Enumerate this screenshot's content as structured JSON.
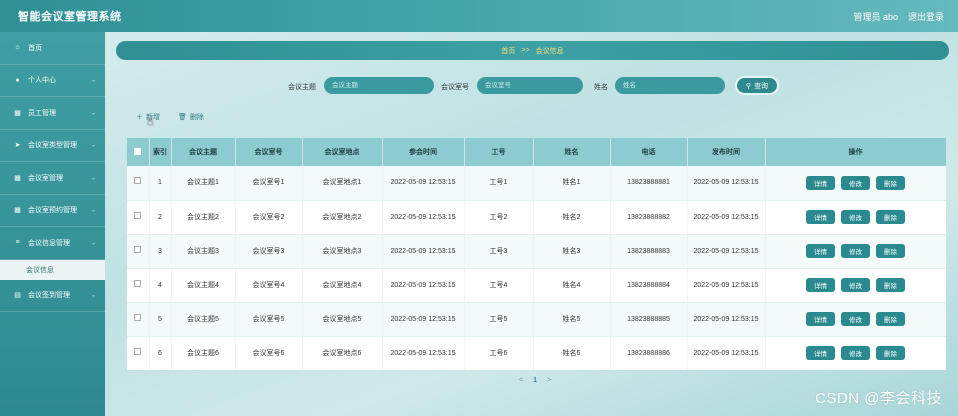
{
  "app": {
    "title": "智能会议室管理系统",
    "user_label": "管理员 abo",
    "logout_label": "退出登录"
  },
  "sidebar": {
    "items": [
      {
        "label": "首页",
        "icon": "home-icon",
        "glyph": "⌂"
      },
      {
        "label": "个人中心",
        "icon": "user-icon",
        "glyph": "●"
      },
      {
        "label": "员工管理",
        "icon": "grid-icon",
        "glyph": "▦"
      },
      {
        "label": "会议室类型管理",
        "icon": "send-icon",
        "glyph": "➤"
      },
      {
        "label": "会议室管理",
        "icon": "grid-icon",
        "glyph": "▦"
      },
      {
        "label": "会议室预约管理",
        "icon": "grid-icon",
        "glyph": "▦"
      },
      {
        "label": "会议信息管理",
        "icon": "list-icon",
        "glyph": "≡"
      },
      {
        "label": "会议签到管理",
        "icon": "doc-icon",
        "glyph": "▤"
      }
    ],
    "sub_item": "会议信息"
  },
  "breadcrumb": {
    "home": "首页",
    "sep": ">>",
    "current": "会议信息"
  },
  "search": {
    "topic_label": "会议主题",
    "topic_placeholder": "会议主题",
    "room_label": "会议室号",
    "room_placeholder": "会议室号",
    "name_label": "姓名",
    "name_placeholder": "姓名",
    "button_label": "查询"
  },
  "actions": {
    "add": "新增",
    "delete": "删除"
  },
  "table": {
    "headers": [
      "索引",
      "会议主题",
      "会议室号",
      "会议室地点",
      "参会时间",
      "工号",
      "姓名",
      "电话",
      "发布时间",
      "操作"
    ],
    "rows": [
      [
        "1",
        "会议主题1",
        "会议室号1",
        "会议室地点1",
        "2022-05-09 12:53:15",
        "工号1",
        "姓名1",
        "13823888881",
        "2022-05-09 12:53:15"
      ],
      [
        "2",
        "会议主题2",
        "会议室号2",
        "会议室地点2",
        "2022-05-09 12:53:15",
        "工号2",
        "姓名2",
        "13823888882",
        "2022-05-09 12:53:15"
      ],
      [
        "3",
        "会议主题3",
        "会议室号3",
        "会议室地点3",
        "2022-05-09 12:53:15",
        "工号3",
        "姓名3",
        "13823888883",
        "2022-05-09 12:53:15"
      ],
      [
        "4",
        "会议主题4",
        "会议室号4",
        "会议室地点4",
        "2022-05-09 12:53:15",
        "工号4",
        "姓名4",
        "13823888884",
        "2022-05-09 12:53:15"
      ],
      [
        "5",
        "会议主题5",
        "会议室号5",
        "会议室地点5",
        "2022-05-09 12:53:15",
        "工号5",
        "姓名5",
        "13823888885",
        "2022-05-09 12:53:15"
      ],
      [
        "6",
        "会议主题6",
        "会议室号6",
        "会议室地点6",
        "2022-05-09 12:53:15",
        "工号6",
        "姓名6",
        "13823888886",
        "2022-05-09 12:53:15"
      ]
    ],
    "op_labels": {
      "detail": "详情",
      "edit": "修改",
      "delete": "删除"
    }
  },
  "pagination": {
    "prev": "<",
    "current": "1",
    "next": ">"
  },
  "watermark": "CSDN @李会科技"
}
